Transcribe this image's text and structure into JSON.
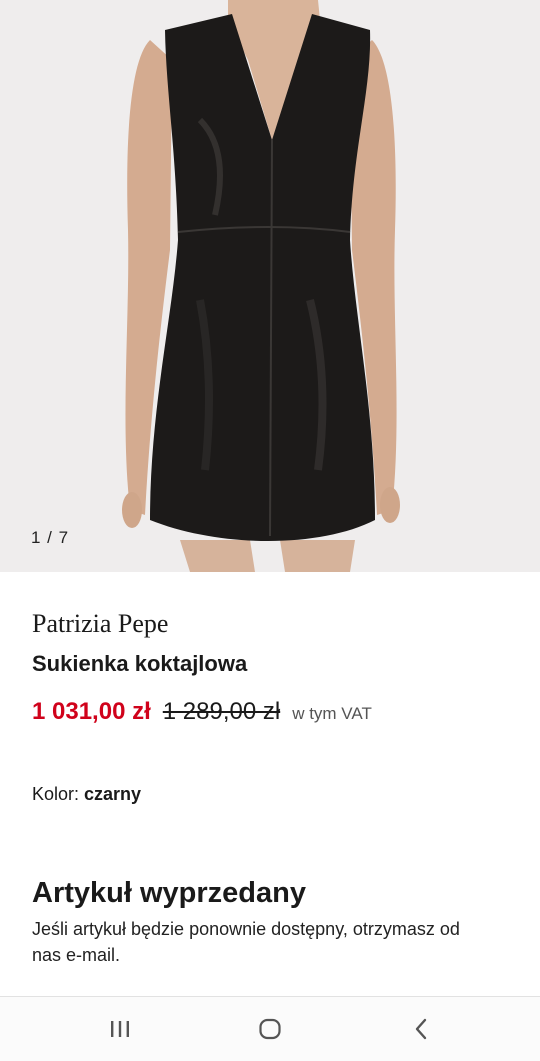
{
  "gallery": {
    "counter": "1 / 7",
    "image_icon": "black-leather-dress-photo"
  },
  "product": {
    "brand": "Patrizia Pepe",
    "name": "Sukienka koktajlowa",
    "price_current": "1 031,00 zł",
    "price_old": "1 289,00 zł",
    "vat_note": "w tym VAT",
    "color_label": "Kolor:",
    "color_value": "czarny",
    "price_color": "#d0021b"
  },
  "availability": {
    "title": "Artykuł wyprzedany",
    "description": "Jeśli artykuł będzie ponownie dostępny, otrzymasz od nas e-mail."
  },
  "navbar": {
    "recent_icon": "recent-apps-icon",
    "home_icon": "home-icon",
    "back_icon": "back-icon"
  }
}
